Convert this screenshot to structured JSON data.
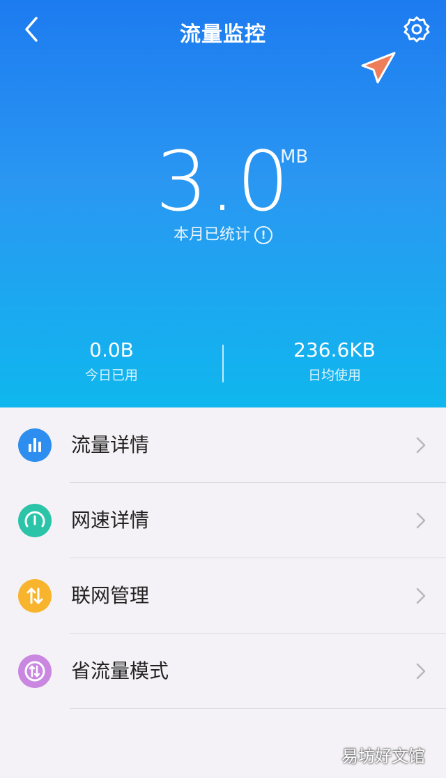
{
  "header": {
    "title": "流量监控"
  },
  "summary": {
    "value": "3.0",
    "unit": "MB",
    "caption": "本月已统计",
    "today_value": "0.0B",
    "today_label": "今日已用",
    "avg_value": "236.6KB",
    "avg_label": "日均使用"
  },
  "menu": [
    {
      "label": "流量详情",
      "icon": "bar-chart-icon",
      "color": "#2e8ef0"
    },
    {
      "label": "网速详情",
      "icon": "speedometer-icon",
      "color": "#2cc4a8"
    },
    {
      "label": "联网管理",
      "icon": "up-down-arrows-icon",
      "color": "#f7b42c"
    },
    {
      "label": "省流量模式",
      "icon": "save-data-icon",
      "color": "#c987e0"
    }
  ],
  "watermark": "易坊好文馆",
  "colors": {
    "hero_top": "#1d7bf0",
    "hero_bottom": "#0fb7ee",
    "pointer": "#ee7d5a"
  }
}
